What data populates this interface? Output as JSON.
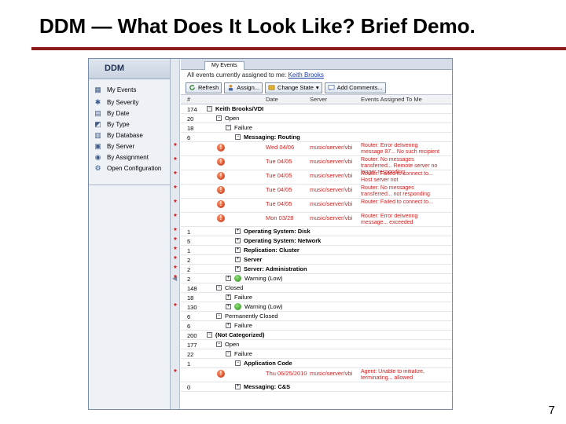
{
  "slide": {
    "title": "DDM — What Does It Look Like? Brief Demo.",
    "page_number": "7"
  },
  "nav": {
    "header": "DDM",
    "items": [
      {
        "label": "My Events",
        "icon": "events-icon"
      },
      {
        "label": "By Severity",
        "icon": "severity-icon"
      },
      {
        "label": "By Date",
        "icon": "date-icon"
      },
      {
        "label": "By Type",
        "icon": "type-icon"
      },
      {
        "label": "By Database",
        "icon": "database-icon"
      },
      {
        "label": "By Server",
        "icon": "server-icon"
      },
      {
        "label": "By Assignment",
        "icon": "assignment-icon"
      },
      {
        "label": "Open Configuration",
        "icon": "configuration-icon"
      }
    ]
  },
  "main": {
    "tab_label": "My Events",
    "info_prefix": "All events currently assigned to me:",
    "info_user": "Keith Brooks",
    "toolbar": {
      "refresh": "Refresh",
      "assign": "Assign...",
      "change_state": "Change State",
      "add_comments": "Add Comments..."
    },
    "columns": {
      "num": "#",
      "date": "Date",
      "server": "Server",
      "event": "Events Assigned To Me"
    }
  },
  "rows": [
    {
      "num": "174",
      "indent": 0,
      "box": "-",
      "label": "Keith Brooks/VDI",
      "bold": true
    },
    {
      "num": "20",
      "indent": 1,
      "box": "-",
      "label": "Open",
      "bold": false
    },
    {
      "num": "18",
      "indent": 2,
      "box": "-",
      "label": "Failure",
      "bold": false
    },
    {
      "num": "6",
      "indent": 3,
      "box": "-",
      "label": "Messaging: Routing",
      "bold": true
    },
    {
      "star": true,
      "sev": "red",
      "date": "Wed 04/06",
      "server": "music/server/vbi",
      "event": "Router: Error delivering message 87... No such recipient",
      "tall": true
    },
    {
      "star": true,
      "sev": "red",
      "date": "Tue 04/05",
      "server": "music/server/vbi",
      "event": "Router: No messages transferred... Remote server no longer responding",
      "tall": true
    },
    {
      "star": true,
      "sev": "red",
      "date": "Tue 04/05",
      "server": "music/server/vbi",
      "event": "Router: Failed to connect to... Host server not",
      "tall": true
    },
    {
      "star": true,
      "sev": "red",
      "date": "Tue 04/05",
      "server": "music/server/vbi",
      "event": "Router: No messages transferred... not responding",
      "tall": true
    },
    {
      "star": true,
      "sev": "red",
      "date": "Tue 04/05",
      "server": "music/server/vbi",
      "event": "Router: Failed to connect to...",
      "tall": true
    },
    {
      "star": true,
      "sev": "red",
      "date": "Mon 03/28",
      "server": "music/server/vbi",
      "event": "Router: Error delivering message... exceeded",
      "tall": true
    },
    {
      "star": true,
      "num": "1",
      "indent": 3,
      "box": "+",
      "label": "Operating System: Disk",
      "bold": true
    },
    {
      "star": true,
      "num": "5",
      "indent": 3,
      "box": "+",
      "label": "Operating System: Network",
      "bold": true
    },
    {
      "star": true,
      "num": "1",
      "indent": 3,
      "box": "+",
      "label": "Replication: Cluster",
      "bold": true
    },
    {
      "star": true,
      "num": "2",
      "indent": 3,
      "box": "+",
      "label": "Server",
      "bold": true
    },
    {
      "star": true,
      "num": "2",
      "indent": 3,
      "box": "+",
      "label": "Server: Administration",
      "bold": true
    },
    {
      "star": true,
      "num": "2",
      "indent": 2,
      "box": "+",
      "label": "Warning (Low)",
      "bold": false,
      "sev": "green"
    },
    {
      "num": "148",
      "indent": 1,
      "box": "-",
      "label": "Closed",
      "bold": false
    },
    {
      "num": "18",
      "indent": 2,
      "box": "+",
      "label": "Failure",
      "bold": false
    },
    {
      "star": true,
      "num": "130",
      "indent": 2,
      "box": "+",
      "label": "Warning (Low)",
      "bold": false,
      "sev": "green"
    },
    {
      "num": "6",
      "indent": 1,
      "box": "-",
      "label": "Permanently Closed",
      "bold": false
    },
    {
      "num": "6",
      "indent": 2,
      "box": "+",
      "label": "Failure",
      "bold": false
    },
    {
      "num": "200",
      "indent": 0,
      "box": "-",
      "label": "(Not Categorized)",
      "bold": true
    },
    {
      "num": "177",
      "indent": 1,
      "box": "-",
      "label": "Open",
      "bold": false
    },
    {
      "num": "22",
      "indent": 2,
      "box": "-",
      "label": "Failure",
      "bold": false
    },
    {
      "num": "1",
      "indent": 3,
      "box": "-",
      "label": "Application Code",
      "bold": true
    },
    {
      "star": true,
      "sev": "red",
      "date": "Thu 06/25/2010",
      "server": "music/server/vbi",
      "event": "Agent: Unable to initialize, terminating... allowed",
      "tall": true
    },
    {
      "num": "0",
      "indent": 3,
      "box": "+",
      "label": "Messaging: C&S",
      "bold": true
    }
  ]
}
